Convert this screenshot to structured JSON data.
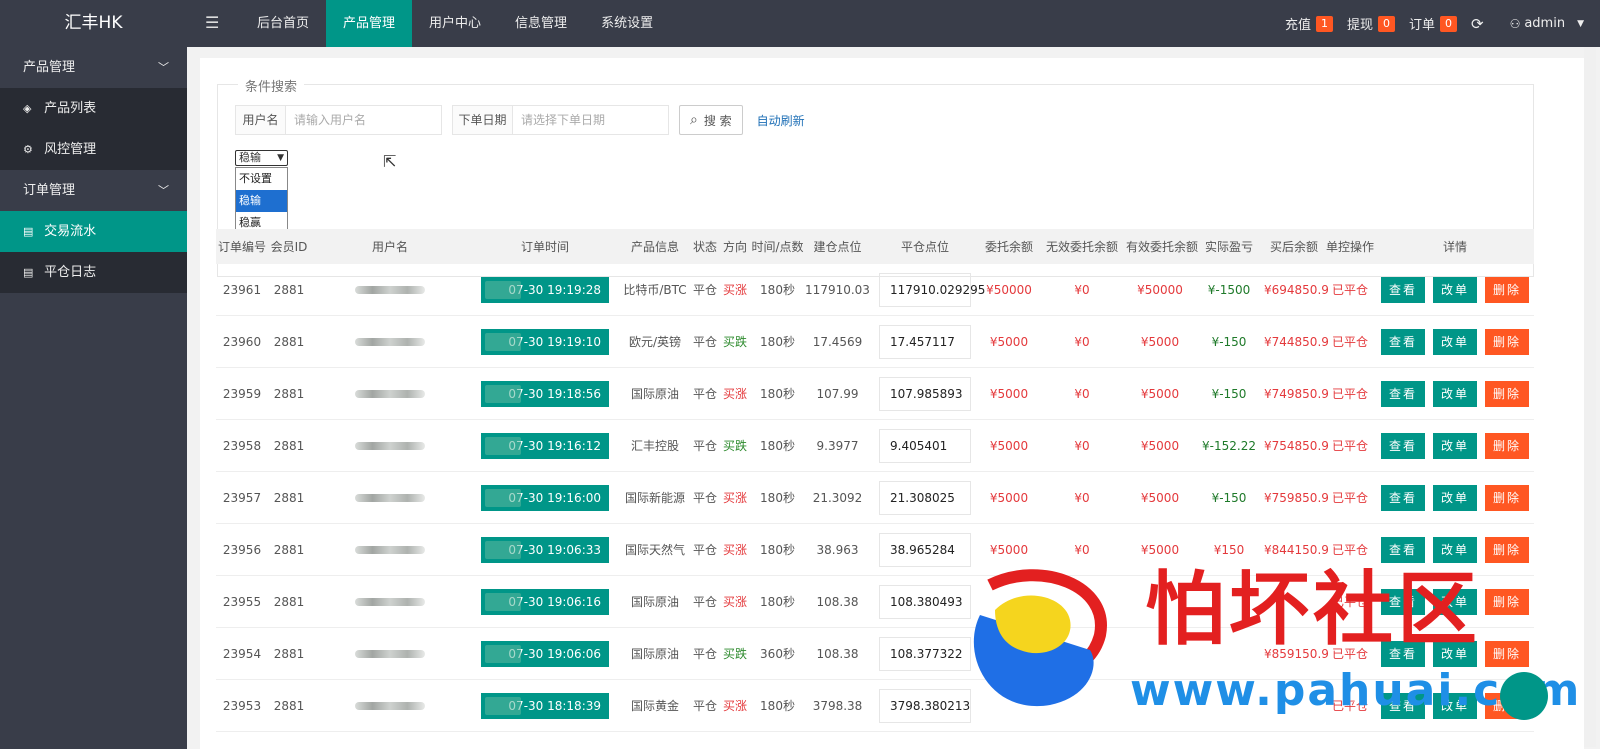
{
  "app": {
    "title": "汇丰HK"
  },
  "topnav": {
    "items": [
      "后台首页",
      "产品管理",
      "用户中心",
      "信息管理",
      "系统设置"
    ],
    "active_index": 1
  },
  "topright": {
    "recharge_label": "充值",
    "recharge_count": "1",
    "withdraw_label": "提现",
    "withdraw_count": "0",
    "order_label": "订单",
    "order_count": "0",
    "user_name": "admin"
  },
  "sidebar": {
    "group1": "产品管理",
    "item_product_list": "产品列表",
    "item_risk": "风控管理",
    "group2": "订单管理",
    "item_trades": "交易流水",
    "item_close_log": "平仓日志"
  },
  "search": {
    "legend": "条件搜索",
    "username_label": "用户名",
    "username_placeholder": "请输入用户名",
    "date_label": "下单日期",
    "date_placeholder": "请选择下单日期",
    "search_button": "搜 索",
    "autorefresh": "自动刷新"
  },
  "select": {
    "value": "稳输",
    "options": [
      "不设置",
      "稳输",
      "稳赢"
    ],
    "selected_index": 1
  },
  "table": {
    "headers": [
      "订单编号",
      "会员ID",
      "用户名",
      "订单时间",
      "产品信息",
      "状态",
      "方向",
      "时间/点数",
      "建仓点位",
      "平仓点位",
      "委托余额",
      "无效委托余额",
      "有效委托余额",
      "实际盈亏",
      "买后余额",
      "单控操作",
      "详情"
    ],
    "btn_view": "查看",
    "btn_edit": "改单",
    "btn_delete": "删除",
    "rows": [
      {
        "id": "23961",
        "mid": "2881",
        "time": "07-30 19:19:28",
        "product": "比特币/BTC",
        "status": "平仓",
        "dir": "买涨",
        "dur": "180秒",
        "open": "117910.03",
        "close": "117910.029295",
        "entrust": "¥50000",
        "invalid": "¥0",
        "valid": "¥50000",
        "pl": "¥-1500",
        "after": "¥694850.9",
        "ctrl": "已平仓"
      },
      {
        "id": "23960",
        "mid": "2881",
        "time": "07-30 19:19:10",
        "product": "欧元/英镑",
        "status": "平仓",
        "dir": "买跌",
        "dur": "180秒",
        "open": "17.4569",
        "close": "17.457117",
        "entrust": "¥5000",
        "invalid": "¥0",
        "valid": "¥5000",
        "pl": "¥-150",
        "after": "¥744850.9",
        "ctrl": "已平仓"
      },
      {
        "id": "23959",
        "mid": "2881",
        "time": "07-30 19:18:56",
        "product": "国际原油",
        "status": "平仓",
        "dir": "买涨",
        "dur": "180秒",
        "open": "107.99",
        "close": "107.985893",
        "entrust": "¥5000",
        "invalid": "¥0",
        "valid": "¥5000",
        "pl": "¥-150",
        "after": "¥749850.9",
        "ctrl": "已平仓"
      },
      {
        "id": "23958",
        "mid": "2881",
        "time": "07-30 19:16:12",
        "product": "汇丰控股",
        "status": "平仓",
        "dir": "买跌",
        "dur": "180秒",
        "open": "9.3977",
        "close": "9.405401",
        "entrust": "¥5000",
        "invalid": "¥0",
        "valid": "¥5000",
        "pl": "¥-152.22",
        "after": "¥754850.9",
        "ctrl": "已平仓"
      },
      {
        "id": "23957",
        "mid": "2881",
        "time": "07-30 19:16:00",
        "product": "国际新能源",
        "status": "平仓",
        "dir": "买涨",
        "dur": "180秒",
        "open": "21.3092",
        "close": "21.308025",
        "entrust": "¥5000",
        "invalid": "¥0",
        "valid": "¥5000",
        "pl": "¥-150",
        "after": "¥759850.9",
        "ctrl": "已平仓"
      },
      {
        "id": "23956",
        "mid": "2881",
        "time": "07-30 19:06:33",
        "product": "国际天然气",
        "status": "平仓",
        "dir": "买涨",
        "dur": "180秒",
        "open": "38.963",
        "close": "38.965284",
        "entrust": "¥5000",
        "invalid": "¥0",
        "valid": "¥5000",
        "pl": "¥150",
        "after": "¥844150.9",
        "ctrl": "已平仓"
      },
      {
        "id": "23955",
        "mid": "2881",
        "time": "07-30 19:06:16",
        "product": "国际原油",
        "status": "平仓",
        "dir": "买涨",
        "dur": "180秒",
        "open": "108.38",
        "close": "108.380493",
        "entrust": "",
        "invalid": "",
        "valid": "",
        "pl": "",
        "after": "",
        "ctrl": "已平仓"
      },
      {
        "id": "23954",
        "mid": "2881",
        "time": "07-30 19:06:06",
        "product": "国际原油",
        "status": "平仓",
        "dir": "买跌",
        "dur": "360秒",
        "open": "108.38",
        "close": "108.377322",
        "entrust": "",
        "invalid": "",
        "valid": "",
        "pl": "",
        "after": "¥859150.9",
        "ctrl": "已平仓"
      },
      {
        "id": "23953",
        "mid": "2881",
        "time": "07-30 18:18:39",
        "product": "国际黄金",
        "status": "平仓",
        "dir": "买涨",
        "dur": "180秒",
        "open": "3798.38",
        "close": "3798.380213",
        "entrust": "",
        "invalid": "",
        "valid": "",
        "pl": "",
        "after": "",
        "ctrl": "已平仓"
      }
    ]
  },
  "watermark": {
    "text": "怕坏社区",
    "url": "www.pahuai.com"
  },
  "colors": {
    "accent": "#009688",
    "danger": "#ff5722",
    "topbar": "#393d49",
    "profit_up": "#e4393c",
    "profit_down": "#2e8b2e"
  }
}
